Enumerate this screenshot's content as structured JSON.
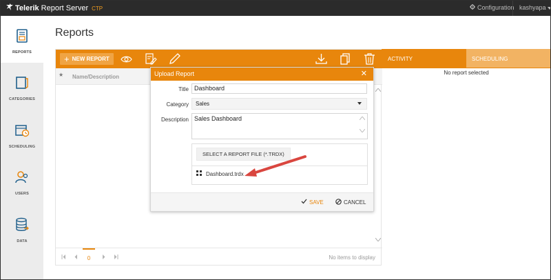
{
  "app": {
    "brand_name_bold": "Telerik",
    "brand_name_rest": "Report Server",
    "brand_badge": "CTP",
    "configuration_label": "Configuration",
    "user_label": "kashyapa"
  },
  "sidebar": {
    "items": [
      {
        "label": "REPORTS",
        "icon": "reports-icon",
        "active": true
      },
      {
        "label": "CATEGORIES",
        "icon": "categories-icon",
        "active": false
      },
      {
        "label": "SCHEDULING",
        "icon": "scheduling-icon",
        "active": false
      },
      {
        "label": "USERS",
        "icon": "users-icon",
        "active": false
      },
      {
        "label": "DATA",
        "icon": "data-icon",
        "active": false
      }
    ]
  },
  "page": {
    "title": "Reports"
  },
  "toolbar": {
    "new_report_label": "NEW REPORT",
    "icons": [
      "view-icon",
      "edit-definition-icon",
      "edit-icon",
      "download-icon",
      "copy-icon",
      "delete-icon"
    ]
  },
  "grid": {
    "columns": [
      "Name/Description"
    ],
    "pager": {
      "current_page": "0",
      "info": "No items to display"
    }
  },
  "right_panel": {
    "tabs": [
      "ACTIVITY",
      "SCHEDULING"
    ],
    "active_tab": "ACTIVITY",
    "empty_message": "No report selected"
  },
  "dialog": {
    "title": "Upload Report",
    "title_label": "Title",
    "title_value": "Dashboard",
    "category_label": "Category",
    "category_value": "Sales",
    "description_label": "Description",
    "description_value": "Sales Dashboard",
    "select_file_label": "SELECT A REPORT FILE (*.TRDX)",
    "file_name": "Dashboard.trdx",
    "save_label": "SAVE",
    "cancel_label": "CANCEL"
  },
  "colors": {
    "accent": "#e8860c",
    "accent_light": "#f2b363",
    "topbar": "#2b2b2b",
    "sidebar": "#ececec",
    "annotation_arrow": "#d9463f"
  }
}
